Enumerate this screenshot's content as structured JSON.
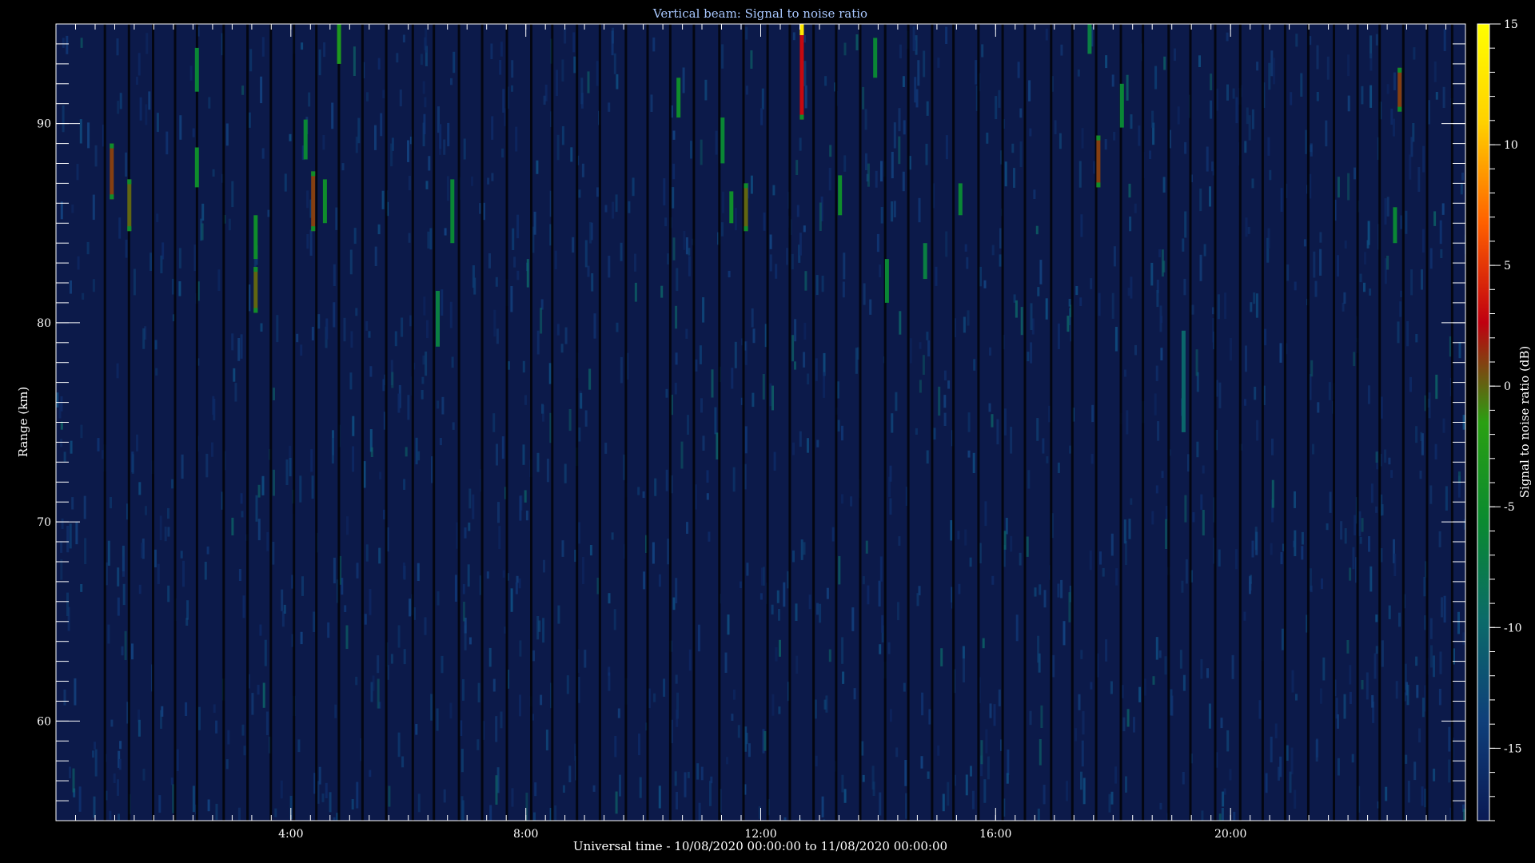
{
  "chart_data": {
    "type": "heatmap",
    "title": "Vertical beam: Signal to noise ratio",
    "xlabel": "Universal time - 10/08/2020 00:00:00 to 11/08/2020 00:00:00",
    "ylabel": "Range (km)",
    "colorbar_label": "Signal to noise ratio (dB)",
    "x_unit": "hours UT",
    "xlim": [
      0,
      24
    ],
    "ylim": [
      55,
      95
    ],
    "x_ticks": [
      {
        "value": 4,
        "label": "4:00"
      },
      {
        "value": 8,
        "label": "8:00"
      },
      {
        "value": 12,
        "label": "12:00"
      },
      {
        "value": 16,
        "label": "16:00"
      },
      {
        "value": 20,
        "label": "20:00"
      }
    ],
    "y_ticks": [
      {
        "value": 60,
        "label": "60"
      },
      {
        "value": 70,
        "label": "70"
      },
      {
        "value": 80,
        "label": "80"
      },
      {
        "value": 90,
        "label": "90"
      }
    ],
    "colorbar_range": [
      -18,
      15
    ],
    "colorbar_ticks": [
      {
        "value": -15,
        "label": "-15"
      },
      {
        "value": -10,
        "label": "-10"
      },
      {
        "value": -5,
        "label": "-5"
      },
      {
        "value": 0,
        "label": "0"
      },
      {
        "value": 5,
        "label": "5"
      },
      {
        "value": 10,
        "label": "10"
      },
      {
        "value": 15,
        "label": "15"
      }
    ],
    "colormap": [
      "#0a1a55",
      "#0f3f7a",
      "#0b6a6a",
      "#0a8a30",
      "#2aa012",
      "#c00010",
      "#ff6000",
      "#ffd000",
      "#ffff00"
    ],
    "background_color": "#0c1a4a",
    "strong_echoes": [
      {
        "t": 0.95,
        "r_low": 86.2,
        "r_high": 89.0,
        "snr": 1
      },
      {
        "t": 1.25,
        "r_low": 84.6,
        "r_high": 87.2,
        "snr": 0
      },
      {
        "t": 2.4,
        "r_low": 91.6,
        "r_high": 93.8,
        "snr": -6
      },
      {
        "t": 2.4,
        "r_low": 86.8,
        "r_high": 88.8,
        "snr": -5
      },
      {
        "t": 3.4,
        "r_low": 83.2,
        "r_high": 85.4,
        "snr": -5
      },
      {
        "t": 3.4,
        "r_low": 80.5,
        "r_high": 82.8,
        "snr": 0
      },
      {
        "t": 4.25,
        "r_low": 88.2,
        "r_high": 90.2,
        "snr": -6
      },
      {
        "t": 4.38,
        "r_low": 84.6,
        "r_high": 87.6,
        "snr": 1
      },
      {
        "t": 4.58,
        "r_low": 85.0,
        "r_high": 87.2,
        "snr": -5
      },
      {
        "t": 4.82,
        "r_low": 93.0,
        "r_high": 95.0,
        "snr": -3
      },
      {
        "t": 6.5,
        "r_low": 78.8,
        "r_high": 81.6,
        "snr": -7
      },
      {
        "t": 6.75,
        "r_low": 84.0,
        "r_high": 87.2,
        "snr": -6
      },
      {
        "t": 10.6,
        "r_low": 90.3,
        "r_high": 92.3,
        "snr": -5
      },
      {
        "t": 11.35,
        "r_low": 88.0,
        "r_high": 90.3,
        "snr": -6
      },
      {
        "t": 11.5,
        "r_low": 85.0,
        "r_high": 86.6,
        "snr": -5
      },
      {
        "t": 11.75,
        "r_low": 84.6,
        "r_high": 87.0,
        "snr": 0
      },
      {
        "t": 12.7,
        "r_low": 90.2,
        "r_high": 95.0,
        "snr": 3
      },
      {
        "t": 13.35,
        "r_low": 85.4,
        "r_high": 87.4,
        "snr": -5
      },
      {
        "t": 13.95,
        "r_low": 92.3,
        "r_high": 94.3,
        "snr": -6
      },
      {
        "t": 14.15,
        "r_low": 81.0,
        "r_high": 83.2,
        "snr": -6
      },
      {
        "t": 14.8,
        "r_low": 82.2,
        "r_high": 84.0,
        "snr": -7
      },
      {
        "t": 15.4,
        "r_low": 85.4,
        "r_high": 87.0,
        "snr": -6
      },
      {
        "t": 17.6,
        "r_low": 93.5,
        "r_high": 95.0,
        "snr": -7
      },
      {
        "t": 17.75,
        "r_low": 86.8,
        "r_high": 89.4,
        "snr": 1
      },
      {
        "t": 18.15,
        "r_low": 89.8,
        "r_high": 92.0,
        "snr": -6
      },
      {
        "t": 19.2,
        "r_low": 74.5,
        "r_high": 79.6,
        "snr": -10
      },
      {
        "t": 22.8,
        "r_low": 84.0,
        "r_high": 85.8,
        "snr": -6
      },
      {
        "t": 22.88,
        "r_low": 90.6,
        "r_high": 92.8,
        "snr": 1
      }
    ]
  }
}
